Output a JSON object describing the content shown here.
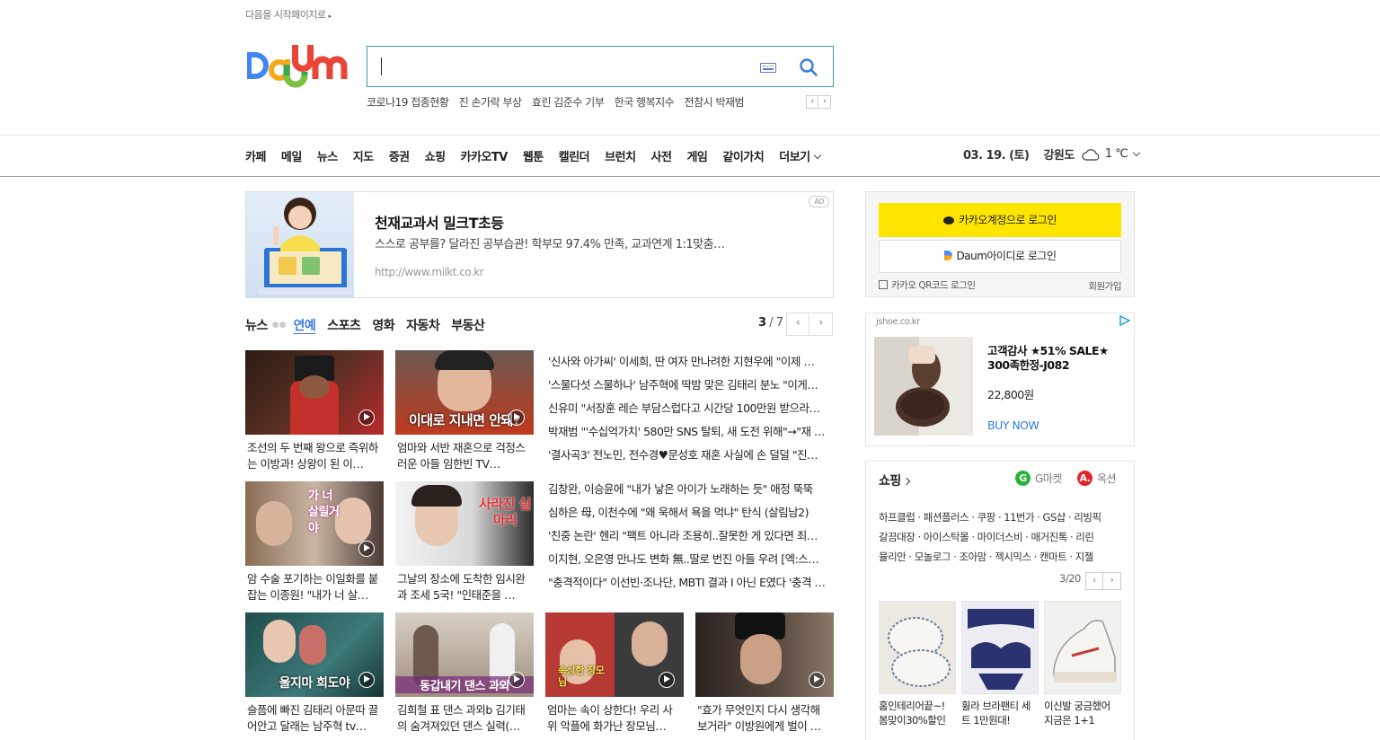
{
  "top": {
    "start_page": "다음을 시작페이지로",
    "arrow": "▸"
  },
  "search": {
    "rising": [
      "코로나19 접종현황",
      "진 손가락 부상",
      "효린 김준수 기부",
      "한국 행복지수",
      "전참시 박재범"
    ],
    "prev": "‹",
    "next": "›"
  },
  "gnb": {
    "items": [
      "카페",
      "메일",
      "뉴스",
      "지도",
      "증권",
      "쇼핑",
      "카카오TV",
      "웹툰",
      "캘린더",
      "브런치",
      "사전",
      "게임",
      "같이가치",
      "더보기"
    ],
    "date": "03. 19. (토)",
    "region": "강원도",
    "temp": "1 ℃",
    "weather_icon": "cloud-icon"
  },
  "ad": {
    "title": "천재교과서 밀크T초등",
    "desc": "스스로 공부를? 달라진 공부습관! 학부모 97.4% 만족, 교과연계 1:1맞춤…",
    "url": "http://www.milkt.co.kr",
    "tag": "AD"
  },
  "news": {
    "tabs": [
      "뉴스",
      "연예",
      "스포츠",
      "영화",
      "자동차",
      "부동산"
    ],
    "active_tab": "연예",
    "page_current": "3",
    "page_total": "/ 7",
    "prev": "‹",
    "next": "›",
    "cards": [
      {
        "caption": "조선의 두 번째 왕으로 즉위하는 이방과! 상왕이 된 이…"
      },
      {
        "caption": "엄마와 서반 재혼으로 걱정스러운 아들 임한빈 TV…",
        "overlay": "이대로 지내면 안돼?"
      },
      {
        "caption": "암 수술 포기하는 이일화를 붙잡는 이종원! \"내가 너 살…",
        "overlay": "가 너 살릴거야"
      },
      {
        "caption": "그날의 장소에 도착한 임시완과 조세 5국! \"인태준을 …",
        "overlay": "사라진 실마리"
      },
      {
        "caption": "슬픔에 빠진 김태리 아문따 끌어안고 달래는 남주혁 tv…",
        "overlay": "울지마 희도야"
      },
      {
        "caption": "김희철 표 댄스 과외b 김기태의 숨겨져있던 댄스 실력(…",
        "overlay": "동갑내기 댄스 과외"
      },
      {
        "caption": "엄마는 속이 상한다! 우리 사위 악플에 화가난 장모님…",
        "overlay": "속상한 장모님"
      },
      {
        "caption": "\"효가 무엇인지 다시 생각해 보거라\" 이방원에게 벌이 …"
      }
    ],
    "headlines_a": [
      "'신사와 아가씨' 이세희, 딴 여자 만나려한 지현우에 \"이제 …",
      "'스물다섯 스물하나' 남주혁에 딱밤 맞은 김태리 분노 \"이게…",
      "신유미 \"서장훈 레슨 부담스럽다고 시간당 100만원 받으라…",
      "박재범 \"'수십억가치' 580만 SNS 탈퇴, 새 도전 위해\"→\"재 …",
      "'결사곡3' 전노민, 전수경♥문성호 재혼 사실에 손 덜덜 \"진…"
    ],
    "headlines_b": [
      "김창완, 이승윤에 \"내가 낳은 아이가 노래하는 듯\" 애정 뚝뚝",
      "심하은 母, 이천수에 \"왜 욱해서 욕을 먹냐\" 탄식 (살림남2)",
      "'친중 논란' 헨리 \"팩트 아니라 조용히..잘못한 게 있다면 죄…",
      "이지현, 오은영 만나도 변화 無..딸로 번진 아들 우려 [엑:스…",
      "\"충격적이다\" 이선빈·조나단, MBTI 결과 I 아닌 E였다 '충격 …"
    ]
  },
  "login": {
    "kakao": "카카오계정으로 로그인",
    "daum": "Daum아이디로 로그인",
    "qr": "카카오 QR코드 로그인",
    "signup": "회원가입"
  },
  "shop_ad": {
    "domain": "jshoe.co.kr",
    "name": "고객감사 ★51% SALE★ 300족한정-J082",
    "price": "22,800원",
    "buy": "BUY NOW"
  },
  "shopping": {
    "title": "쇼핑",
    "gmarket": "G마켓",
    "auction": "옥션",
    "links": [
      "하프클럽 · 패션플러스 · 쿠팡 · 11번가 · GS샵 · 리빙픽",
      "갈끔대장 · 아이스탁몰 · 마이더스비 · 매거진톡 · 리린",
      "뮬리안 · 모놀로그 · 조아맘 · 젝시믹스 · 캔마트 · 지젤"
    ],
    "page": "3/20",
    "prev": "‹",
    "next": "›",
    "products": [
      {
        "title": "홈인테리어끝~! 봄맞이30%할인"
      },
      {
        "title": "휠라 브라팬티 세트 1만원대!"
      },
      {
        "title": "이신발 궁금했어 지금은 1+1"
      }
    ]
  },
  "colors": {
    "accent": "#3b7bdb",
    "kakao": "#fee500",
    "search_border": "#3a97a6"
  }
}
